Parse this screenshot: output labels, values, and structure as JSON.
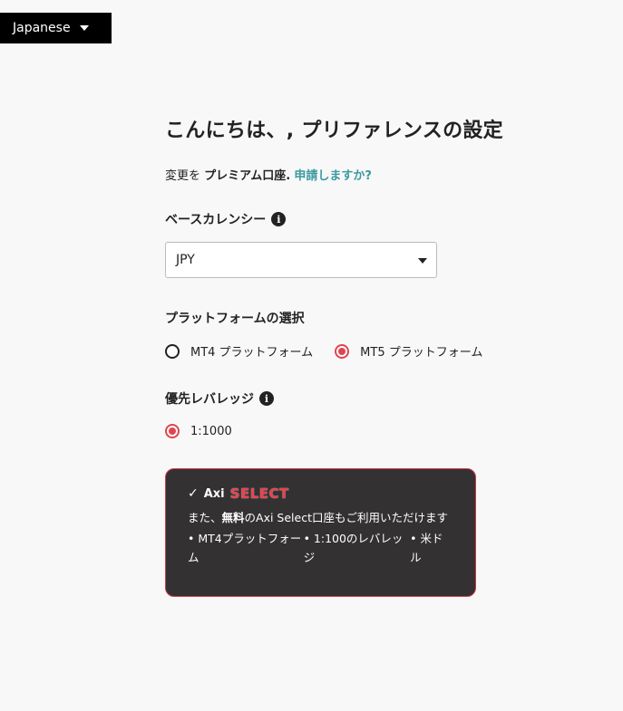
{
  "language": {
    "label": "Japanese"
  },
  "page": {
    "title": "こんにちは、, プリファレンスの設定",
    "subtitle_prefix": "変更を",
    "subtitle_account": "プレミアム口座.",
    "subtitle_link": "申請しますか?"
  },
  "currency": {
    "label": "ベースカレンシー",
    "info_icon": "i",
    "selected": "JPY"
  },
  "platform": {
    "label": "プラットフォームの選択",
    "options": [
      {
        "label": "MT4 プラットフォーム",
        "selected": false
      },
      {
        "label": "MT5 プラットフォーム",
        "selected": true
      }
    ]
  },
  "leverage": {
    "label": "優先レバレッジ",
    "info_icon": "i",
    "options": [
      {
        "label": "1:1000",
        "selected": true
      }
    ]
  },
  "promo": {
    "check_icon": "✓",
    "brand": "Axi",
    "brand_select": "SELECT",
    "text_prefix": "また、",
    "text_bold": "無料",
    "text_suffix": "のAxi Select口座もご利用いただけます",
    "bullets": [
      "• MT4プラットフォーム",
      "• 1:100のレバレッジ",
      "• 米ドル"
    ]
  },
  "colors": {
    "accent_red": "#e0454f",
    "link_teal": "#3a9a9f",
    "promo_bg": "#333132"
  }
}
